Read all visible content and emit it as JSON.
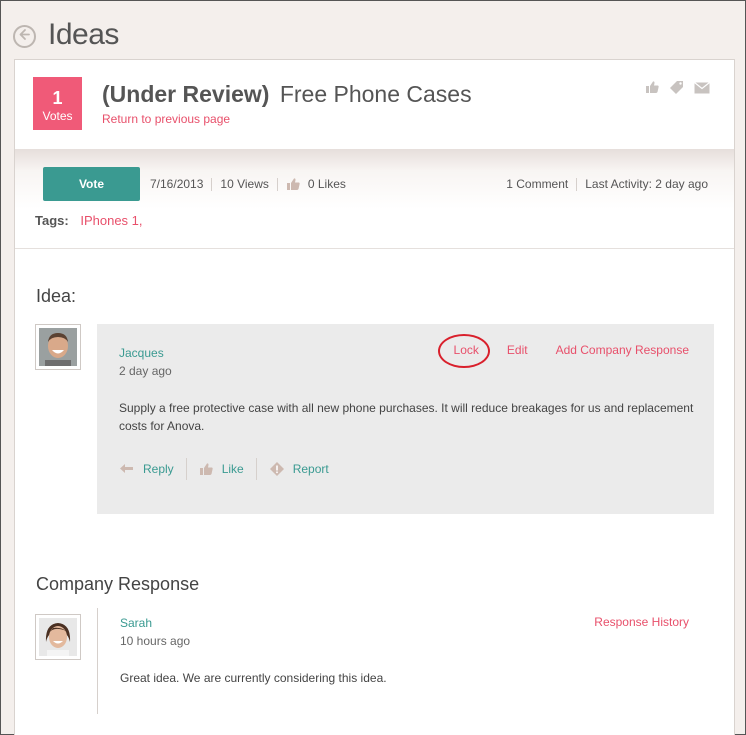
{
  "page": {
    "title": "Ideas"
  },
  "idea": {
    "votes_count": "1",
    "votes_label": "Votes",
    "status": "(Under Review)",
    "title": "Free Phone Cases",
    "return_link": "Return to previous page",
    "vote_button": "Vote",
    "date": "7/16/2013",
    "views": "10 Views",
    "likes": "0 Likes",
    "comments": "1 Comment",
    "last_activity": "Last Activity: 2 day ago",
    "tags_label": "Tags:",
    "tags": [
      "IPhones 1,"
    ]
  },
  "idea_section": {
    "heading": "Idea:",
    "author": "Jacques",
    "time": "2 day ago",
    "actions": {
      "lock": "Lock",
      "edit": "Edit",
      "add_response": "Add Company Response"
    },
    "text": "Supply a free protective case with all new phone purchases. It will reduce breakages for us and replacement costs for Anova.",
    "reply": "Reply",
    "like": "Like",
    "report": "Report"
  },
  "response_section": {
    "heading": "Company Response",
    "author": "Sarah",
    "time": "10 hours ago",
    "history_link": "Response History",
    "text": "Great idea. We are currently considering this idea."
  },
  "icons": {
    "back": "back-arrow-icon",
    "thumbs_up": "thumbs-up-icon",
    "tag": "tag-icon",
    "mail": "mail-icon",
    "reply": "reply-arrow-icon",
    "report": "report-diamond-icon"
  },
  "colors": {
    "accent_pink": "#e8506b",
    "votes_bg": "#f05a78",
    "teal": "#3a9a91",
    "circle_annotation": "#d9202c"
  }
}
